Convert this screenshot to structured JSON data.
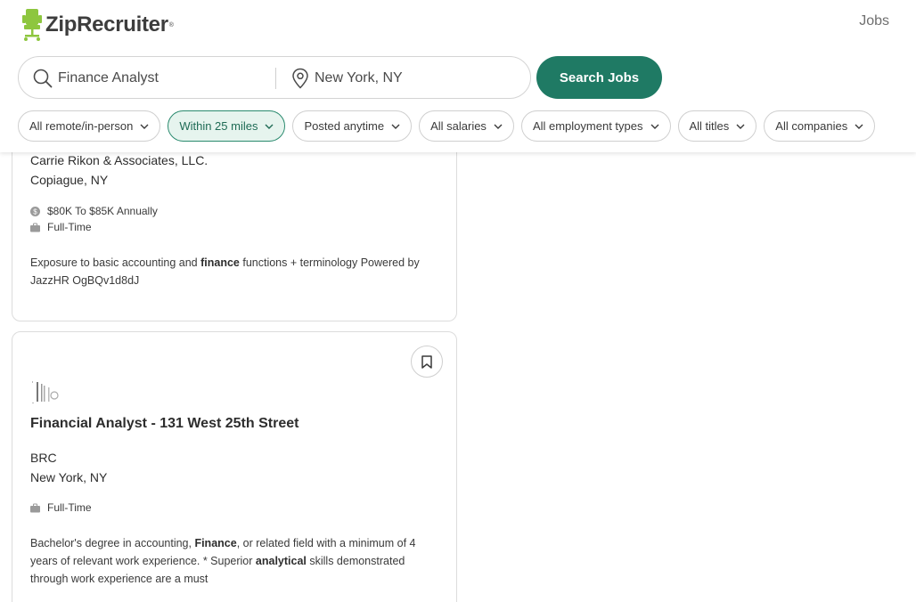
{
  "header": {
    "logo_text": "ZipRecruiter",
    "logo_tm": "®",
    "nav_jobs": "Jobs",
    "brand_color": "#8dc63f"
  },
  "search": {
    "keyword_value": "Finance Analyst",
    "location_value": "New York, NY",
    "button_label": "Search Jobs",
    "button_color": "#1f7a64"
  },
  "filters": [
    {
      "label": "All remote/in-person",
      "active": false
    },
    {
      "label": "Within 25 miles",
      "active": true
    },
    {
      "label": "Posted anytime",
      "active": false
    },
    {
      "label": "All salaries",
      "active": false
    },
    {
      "label": "All employment types",
      "active": false
    },
    {
      "label": "All titles",
      "active": false
    },
    {
      "label": "All companies",
      "active": false
    }
  ],
  "jobs": [
    {
      "company": "Carrie Rikon & Associates, LLC.",
      "location": "Copiague, NY",
      "salary": "$80K To $85K Annually",
      "type": "Full-Time",
      "desc_parts": [
        {
          "t": "Exposure to basic accounting and ",
          "b": false
        },
        {
          "t": "finance",
          "b": true
        },
        {
          "t": " functions + terminology Powered by JazzHR OgBQv1d8dJ",
          "b": false
        }
      ]
    },
    {
      "title": "Financial Analyst - 131 West 25th Street",
      "company": "BRC",
      "location": "New York, NY",
      "type": "Full-Time",
      "desc_parts": [
        {
          "t": "Bachelor's degree in accounting, ",
          "b": false
        },
        {
          "t": "Finance",
          "b": true
        },
        {
          "t": ", or related field with a minimum of 4 years of relevant work experience. * Superior ",
          "b": false
        },
        {
          "t": "analytical",
          "b": true
        },
        {
          "t": " skills demonstrated through work experience are a must",
          "b": false
        }
      ]
    }
  ]
}
